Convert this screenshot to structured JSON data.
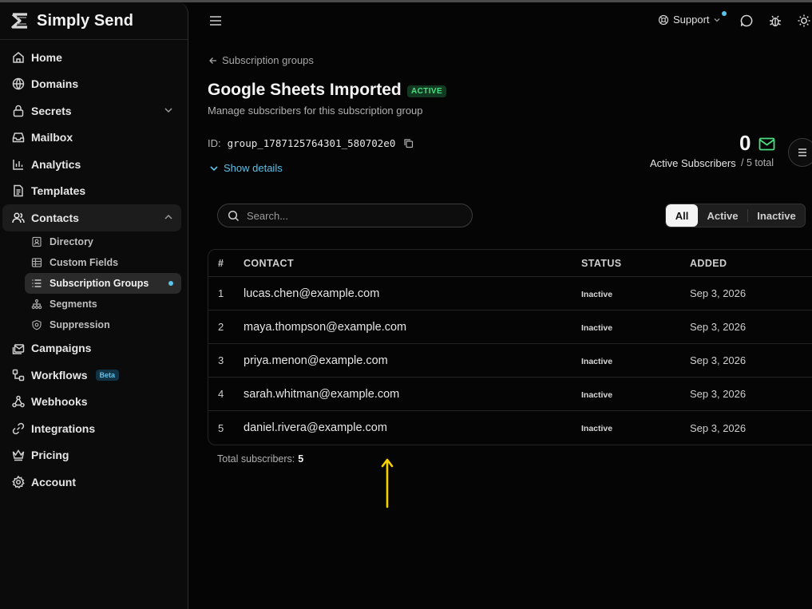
{
  "app": {
    "brand": "Simply Send"
  },
  "nav": {
    "home": "Home",
    "domains": "Domains",
    "secrets": "Secrets",
    "mailbox": "Mailbox",
    "analytics": "Analytics",
    "templates": "Templates",
    "contacts": "Contacts",
    "contacts_sub": {
      "directory": "Directory",
      "custom_fields": "Custom Fields",
      "subscription_groups": "Subscription Groups",
      "segments": "Segments",
      "suppression": "Suppression"
    },
    "campaigns": "Campaigns",
    "workflows": "Workflows",
    "workflows_badge": "Beta",
    "webhooks": "Webhooks",
    "integrations": "Integrations",
    "pricing": "Pricing",
    "account": "Account"
  },
  "topbar": {
    "support": "Support"
  },
  "page": {
    "breadcrumb": "Subscription groups",
    "title": "Google Sheets Imported",
    "status_badge": "ACTIVE",
    "subtitle": "Manage subscribers for this subscription group",
    "id_label": "ID:",
    "id_value": "group_1787125764301_580702e0",
    "show_details": "Show details",
    "active_count": "0",
    "active_label": "Active Subscribers",
    "total_label": "/ 5 total"
  },
  "search": {
    "placeholder": "Search..."
  },
  "filters": {
    "all": "All",
    "active": "Active",
    "inactive": "Inactive",
    "selected": "All"
  },
  "table": {
    "headers": {
      "num": "#",
      "contact": "CONTACT",
      "status": "STATUS",
      "added": "ADDED"
    },
    "rows": [
      {
        "num": "1",
        "contact": "lucas.chen@example.com",
        "status": "Inactive",
        "added": "Sep 3, 2026"
      },
      {
        "num": "2",
        "contact": "maya.thompson@example.com",
        "status": "Inactive",
        "added": "Sep 3, 2026"
      },
      {
        "num": "3",
        "contact": "priya.menon@example.com",
        "status": "Inactive",
        "added": "Sep 3, 2026"
      },
      {
        "num": "4",
        "contact": "sarah.whitman@example.com",
        "status": "Inactive",
        "added": "Sep 3, 2026"
      },
      {
        "num": "5",
        "contact": "daniel.rivera@example.com",
        "status": "Inactive",
        "added": "Sep 3, 2026"
      }
    ]
  },
  "footer": {
    "total_label": "Total subscribers:",
    "total_value": "5"
  },
  "colors": {
    "accent": "#5bc2e8",
    "success": "#4ade80",
    "annotation_arrow": "#f5d000"
  }
}
